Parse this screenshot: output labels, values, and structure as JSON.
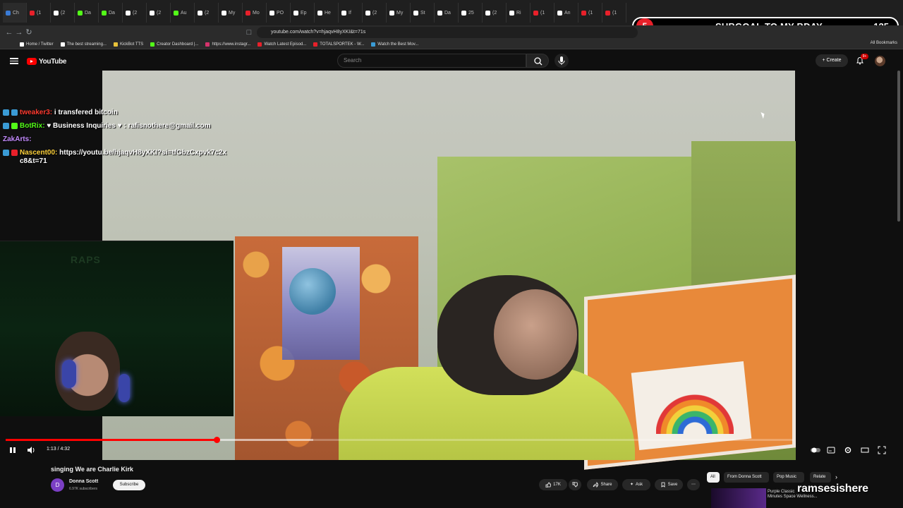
{
  "browser": {
    "tabs": [
      {
        "label": "Ch",
        "color": "#3a7bd5"
      },
      {
        "label": "(1",
        "color": "#e8202a"
      },
      {
        "label": "(2",
        "color": "#ffffff"
      },
      {
        "label": "Da",
        "color": "#53fc18"
      },
      {
        "label": "Da",
        "color": "#53fc18"
      },
      {
        "label": "(2",
        "color": "#ffffff"
      },
      {
        "label": "(2",
        "color": "#ffffff"
      },
      {
        "label": "Au",
        "color": "#53fc18"
      },
      {
        "label": "(2",
        "color": "#ffffff"
      },
      {
        "label": "My",
        "color": "#ffffff"
      },
      {
        "label": "Mo",
        "color": "#e8202a"
      },
      {
        "label": "PO",
        "color": "#ffffff"
      },
      {
        "label": "Ep",
        "color": "#ffffff"
      },
      {
        "label": "He",
        "color": "#ffffff"
      },
      {
        "label": "If",
        "color": "#ffffff"
      },
      {
        "label": "(2",
        "color": "#ffffff"
      },
      {
        "label": "My",
        "color": "#ffffff"
      },
      {
        "label": "St",
        "color": "#ffffff"
      },
      {
        "label": "Da",
        "color": "#ffffff"
      },
      {
        "label": "25",
        "color": "#ffffff"
      },
      {
        "label": "(2",
        "color": "#ffffff"
      },
      {
        "label": "Ri",
        "color": "#ffffff"
      },
      {
        "label": "(1",
        "color": "#e8202a"
      },
      {
        "label": "An",
        "color": "#ffffff"
      },
      {
        "label": "(1",
        "color": "#e8202a"
      },
      {
        "label": "(1",
        "color": "#e8202a"
      }
    ],
    "url": "youtube.com/watch?v=hjaqvH8yXKI&t=71s",
    "bookmarks": [
      {
        "label": "Home / Twitter",
        "color": "#ffffff"
      },
      {
        "label": "The best streaming...",
        "color": "#ffffff"
      },
      {
        "label": "KickBot TTS",
        "color": "#e8c23a"
      },
      {
        "label": "Creator Dashboard |...",
        "color": "#53fc18"
      },
      {
        "label": "https://www.instagr...",
        "color": "#d6336c"
      },
      {
        "label": "Watch Latest Episod...",
        "color": "#e8202a"
      },
      {
        "label": "TOTALSPORTEK - W...",
        "color": "#e8202a"
      },
      {
        "label": "Watch the Best Mov...",
        "color": "#3a9bd5"
      }
    ],
    "all_bookmarks_label": "All Bookmarks"
  },
  "overlay": {
    "subgoal_badge": "5",
    "subgoal_text": "SUBGOAL TO MY BDAY",
    "subgoal_count": "125",
    "watermark": "ramsesishere"
  },
  "youtube": {
    "logo_text": "YouTube",
    "search_placeholder": "Search",
    "create_label": "Create",
    "notification_count": "9+"
  },
  "chat": [
    {
      "user": "tweaker3:",
      "user_color": "#ff3b30",
      "message": "i transfered bitcoin",
      "badge_colors": [
        "#3a9bd5",
        "#3a9bd5"
      ]
    },
    {
      "user": "BotRix:",
      "user_color": "#53fc18",
      "message": "♥ Business Inquiries ♥ : rafisnothere@gmail.com",
      "badge_colors": [
        "#3a9bd5",
        "#53fc18"
      ]
    },
    {
      "user": "ZakArts:",
      "user_color": "#c58cff",
      "message": "",
      "badge_colors": []
    },
    {
      "user": "Nascent00:",
      "user_color": "#ffd23b",
      "message": "https://youtu.be/hjaqvH8yXKI?si=tfGbzCxpvk7c2xc8&t=71",
      "badge_colors": [
        "#3a9bd5",
        "#e8202a"
      ]
    }
  ],
  "player": {
    "current_time": "1:13",
    "duration": "4:32",
    "time_display": "1:13 / 4:32",
    "played_fraction": 0.268,
    "buffered_fraction": 0.39
  },
  "video": {
    "title": "singing We are Charlie Kirk",
    "channel_initial": "D",
    "channel_name": "Donna Scott",
    "subscribers": "6.97K subscribers",
    "subscribe_label": "Subscribe",
    "like_count": "17K",
    "share_label": "Share",
    "ask_label": "Ask",
    "save_label": "Save"
  },
  "recommend_chips": [
    "All",
    "From Donna Scott",
    "Pop Music",
    "Relate"
  ],
  "sidebar_preview": {
    "title_line1": "Purple Classic",
    "title_line2": "Minutes Space Wellness..."
  }
}
